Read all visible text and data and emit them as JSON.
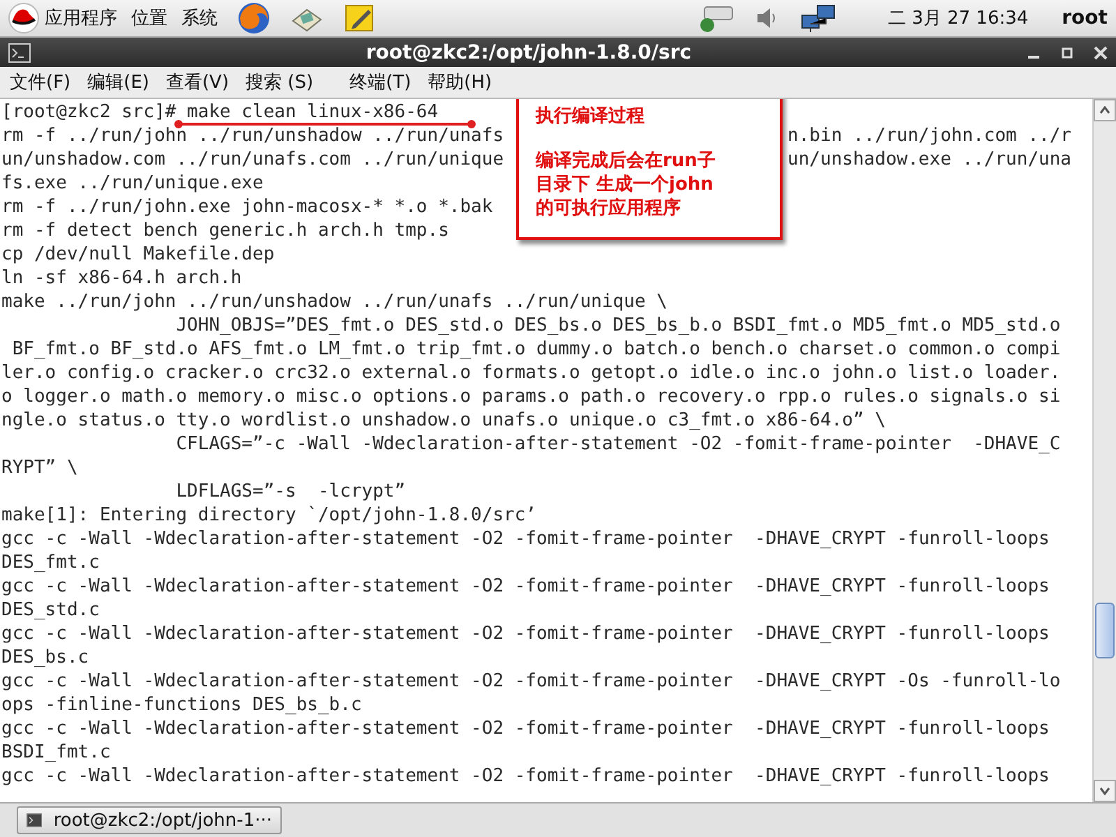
{
  "top_panel": {
    "menus": [
      "应用程序",
      "位置",
      "系统"
    ],
    "clock": "二 3月 27 16:34",
    "user": "root"
  },
  "window": {
    "title": "root@zkc2:/opt/john-1.8.0/src"
  },
  "menu_bar": [
    "文件(F)",
    "编辑(E)",
    "查看(V)",
    "搜索 (S)",
    "终端(T)",
    "帮助(H)"
  ],
  "terminal": {
    "lines": [
      {
        "text": "[root@zkc2 src]# make clean linux-x86-64"
      },
      {
        "left": "rm -f ../run/john ../run/unshadow ../run/unafs",
        "right": "n.bin ../run/john.com ../r"
      },
      {
        "left": "un/unshadow.com ../run/unafs.com ../run/unique",
        "right": "un/unshadow.exe ../run/una"
      },
      {
        "text": "fs.exe ../run/unique.exe"
      },
      {
        "text": "rm -f ../run/john.exe john-macosx-* *.o *.bak"
      },
      {
        "text": "rm -f detect bench generic.h arch.h tmp.s"
      },
      {
        "text": "cp /dev/null Makefile.dep"
      },
      {
        "text": "ln -sf x86-64.h arch.h"
      },
      {
        "text": "make ../run/john ../run/unshadow ../run/unafs ../run/unique \\"
      },
      {
        "text": "                JOHN_OBJS=”DES_fmt.o DES_std.o DES_bs.o DES_bs_b.o BSDI_fmt.o MD5_fmt.o MD5_std.o"
      },
      {
        "text": " BF_fmt.o BF_std.o AFS_fmt.o LM_fmt.o trip_fmt.o dummy.o batch.o bench.o charset.o common.o compi"
      },
      {
        "text": "ler.o config.o cracker.o crc32.o external.o formats.o getopt.o idle.o inc.o john.o list.o loader."
      },
      {
        "text": "o logger.o math.o memory.o misc.o options.o params.o path.o recovery.o rpp.o rules.o signals.o si"
      },
      {
        "text": "ngle.o status.o tty.o wordlist.o unshadow.o unafs.o unique.o c3_fmt.o x86-64.o” \\"
      },
      {
        "text": "                CFLAGS=”-c -Wall -Wdeclaration-after-statement -O2 -fomit-frame-pointer  -DHAVE_C"
      },
      {
        "text": "RYPT” \\"
      },
      {
        "text": "                LDFLAGS=”-s  -lcrypt”"
      },
      {
        "text": "make[1]: Entering directory `/opt/john-1.8.0/src’"
      },
      {
        "text": "gcc -c -Wall -Wdeclaration-after-statement -O2 -fomit-frame-pointer  -DHAVE_CRYPT -funroll-loops"
      },
      {
        "text": "DES_fmt.c"
      },
      {
        "text": "gcc -c -Wall -Wdeclaration-after-statement -O2 -fomit-frame-pointer  -DHAVE_CRYPT -funroll-loops"
      },
      {
        "text": "DES_std.c"
      },
      {
        "text": "gcc -c -Wall -Wdeclaration-after-statement -O2 -fomit-frame-pointer  -DHAVE_CRYPT -funroll-loops"
      },
      {
        "text": "DES_bs.c"
      },
      {
        "text": "gcc -c -Wall -Wdeclaration-after-statement -O2 -fomit-frame-pointer  -DHAVE_CRYPT -Os -funroll-lo"
      },
      {
        "text": "ops -finline-functions DES_bs_b.c"
      },
      {
        "text": "gcc -c -Wall -Wdeclaration-after-statement -O2 -fomit-frame-pointer  -DHAVE_CRYPT -funroll-loops"
      },
      {
        "text": "BSDI_fmt.c"
      },
      {
        "text": "gcc -c -Wall -Wdeclaration-after-statement -O2 -fomit-frame-pointer  -DHAVE_CRYPT -funroll-loops"
      }
    ]
  },
  "annotation": {
    "heading": "执行编译过程",
    "note_lines": [
      "编译完成后会在run子",
      "目录下 生成一个john",
      "的可执行应用程序"
    ]
  },
  "taskbar": {
    "items": [
      {
        "label": "root@zkc2:/opt/john-1···"
      }
    ]
  }
}
